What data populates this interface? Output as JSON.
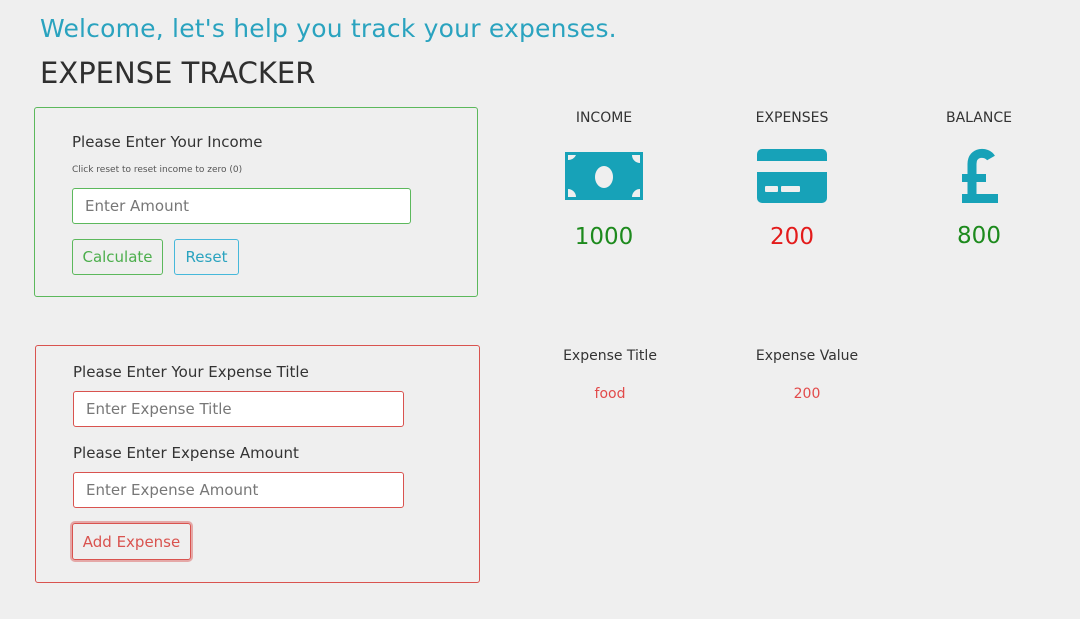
{
  "header": {
    "welcome": "Welcome, let's help you track your expenses.",
    "title": "EXPENSE TRACKER"
  },
  "income_form": {
    "label": "Please Enter Your Income",
    "hint": "Click reset to reset income to zero (0)",
    "placeholder": "Enter Amount",
    "value": "",
    "calculate_label": "Calculate",
    "reset_label": "Reset"
  },
  "summary": {
    "income": {
      "label": "INCOME",
      "value": "1000",
      "icon": "money-bill-icon"
    },
    "expenses": {
      "label": "EXPENSES",
      "value": "200",
      "icon": "credit-card-icon"
    },
    "balance": {
      "label": "BALANCE",
      "value": "800",
      "icon": "pound-sign-icon"
    }
  },
  "expense_form": {
    "title_label": "Please Enter Your Expense Title",
    "title_placeholder": "Enter Expense Title",
    "amount_label": "Please Enter Expense Amount",
    "amount_placeholder": "Enter Expense Amount",
    "add_label": "Add Expense"
  },
  "expense_list": {
    "columns": [
      "Expense Title",
      "Expense Value"
    ],
    "rows": [
      {
        "title": "food",
        "value": "200"
      }
    ]
  },
  "colors": {
    "accent": "#2aa3bf",
    "success": "#5cb85c",
    "danger": "#d9534f",
    "income_value": "#1d8a1d",
    "expense_value": "#e31b1b",
    "icon": "#17a2b8",
    "background": "#efefef"
  }
}
